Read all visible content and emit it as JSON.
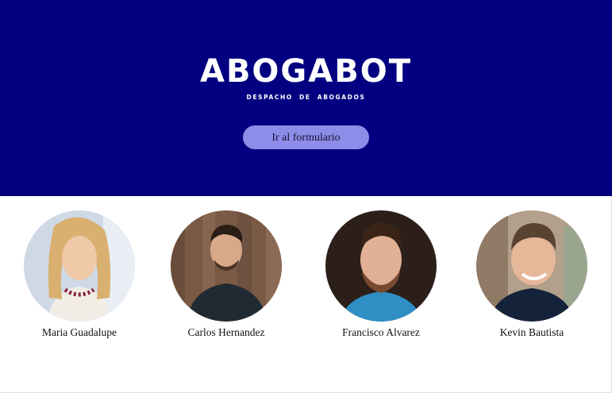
{
  "hero": {
    "brand": "ABOGABOT",
    "tagline": "DESPACHO DE ABOGADOS",
    "cta_label": "Ir al formulario"
  },
  "colors": {
    "hero_background": "#020080",
    "cta_background": "#8d8ce8",
    "text_light": "#ffffff"
  },
  "team": [
    {
      "name": "Maria Guadalupe",
      "photo": "portrait-photo"
    },
    {
      "name": "Carlos Hernandez",
      "photo": "portrait-photo"
    },
    {
      "name": "Francisco Alvarez",
      "photo": "portrait-photo"
    },
    {
      "name": "Kevin Bautista",
      "photo": "portrait-photo"
    }
  ]
}
